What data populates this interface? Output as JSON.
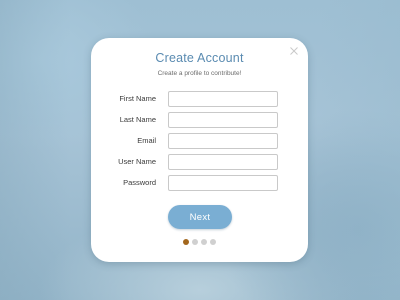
{
  "colors": {
    "accent": "#7aaed3",
    "title": "#5a8bb1",
    "active_dot": "#a3671d",
    "inactive_dot": "#d0d0d0"
  },
  "dialog": {
    "title": "Create Account",
    "subtitle": "Create a profile to contribute!",
    "close_icon": "close-icon"
  },
  "form": {
    "fields": [
      {
        "label": "First Name",
        "value": "",
        "type": "text"
      },
      {
        "label": "Last Name",
        "value": "",
        "type": "text"
      },
      {
        "label": "Email",
        "value": "",
        "type": "email"
      },
      {
        "label": "User Name",
        "value": "",
        "type": "text"
      },
      {
        "label": "Password",
        "value": "",
        "type": "password"
      }
    ]
  },
  "actions": {
    "next_label": "Next"
  },
  "pagination": {
    "total_steps": 4,
    "current_step": 1
  }
}
